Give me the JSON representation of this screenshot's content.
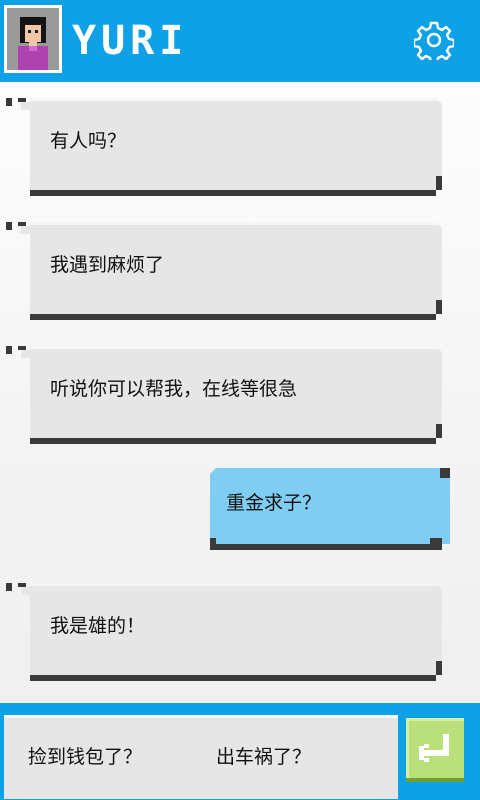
{
  "header": {
    "title": "YURI",
    "avatar_icon": "avatar-icon",
    "settings_icon": "gear-icon",
    "bg_color": "#0ea1e6"
  },
  "messages": [
    {
      "from": "contact",
      "text": "有人吗？"
    },
    {
      "from": "contact",
      "text": "我遇到麻烦了"
    },
    {
      "from": "contact",
      "text": "听说你可以帮我，在线等很急"
    },
    {
      "from": "user",
      "text": "重金求子？"
    },
    {
      "from": "contact",
      "text": "我是雄的！"
    }
  ],
  "reply_options": [
    "捡到钱包了？",
    "出车祸了？"
  ],
  "send_icon": "enter-arrow-icon",
  "colors": {
    "contact_bubble": "#e6e6e6",
    "user_bubble": "#7fcdf2",
    "send_button": "#b9e07b",
    "bubble_shadow": "#3a3a3a"
  }
}
